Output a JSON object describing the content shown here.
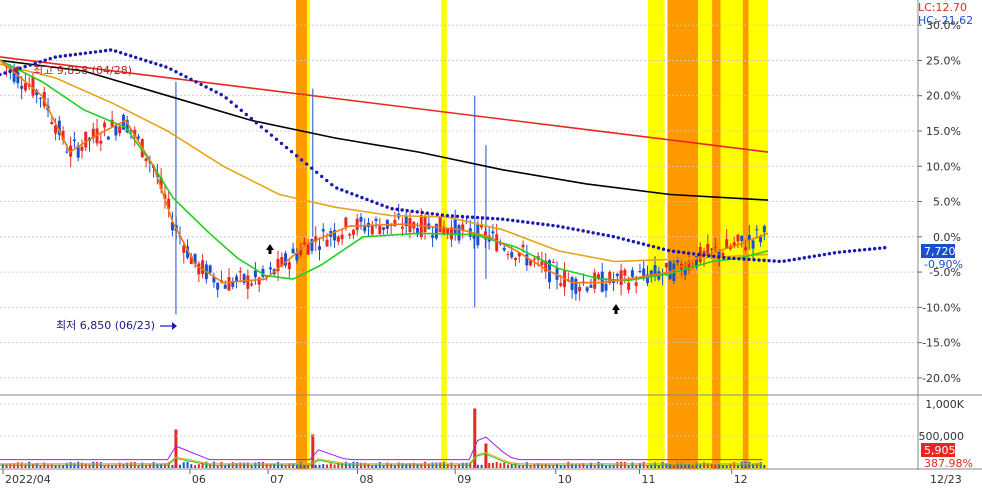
{
  "chart_data": {
    "type": "line",
    "price_panel": {
      "y_axis_unit": "%",
      "yticks": [
        "30.0%",
        "25.0%",
        "20.0%",
        "15.0%",
        "10.0%",
        "5.0%",
        "0.0%",
        "-5.0%",
        "-10.0%",
        "-15.0%",
        "-20.0%"
      ],
      "ytick_values": [
        30,
        25,
        20,
        15,
        10,
        5,
        0,
        -5,
        -10,
        -15,
        -20
      ],
      "ylim": [
        -22,
        33
      ],
      "lc_label": "LC:12.70",
      "hc_label": "HC:-21.62",
      "high_annotation": "최고 9,858 (04/28)",
      "low_annotation": "최저 6,850 (06/23)",
      "current_price_label": "7,720",
      "current_pct_label": "-0.90%",
      "grid": true
    },
    "volume_panel": {
      "yticks": [
        "1,000K",
        "500,000"
      ],
      "current_volume_label": "5,905",
      "volume_pct_label": "387.98%"
    },
    "x_axis": {
      "labels": [
        "2022/04",
        "06",
        "07",
        "08",
        "09",
        "10",
        "11",
        "12",
        "12/23"
      ],
      "label_days": [
        0,
        68,
        96,
        128,
        163,
        199,
        229,
        262,
        0
      ]
    },
    "series": [
      {
        "name": "",
        "color": "#e8281e",
        "x": [
          0,
          275
        ],
        "y": [
          25.5,
          12.0
        ]
      },
      {
        "name": "",
        "color": "#000000",
        "x": [
          0,
          30,
          60,
          90,
          120,
          150,
          180,
          210,
          240,
          275
        ],
        "y": [
          25.0,
          23.5,
          20.0,
          16.5,
          14.0,
          12.0,
          9.5,
          7.5,
          6.0,
          5.2
        ]
      },
      {
        "name": "",
        "color": "#e8a317",
        "x": [
          0,
          20,
          40,
          60,
          80,
          100,
          120,
          140,
          160,
          180,
          200,
          220,
          240,
          260,
          275
        ],
        "y": [
          24.5,
          22.5,
          19.0,
          15.0,
          10.0,
          6.0,
          4.2,
          3.0,
          2.8,
          1.0,
          -2.0,
          -3.5,
          -3.2,
          -2.8,
          -2.5
        ]
      },
      {
        "name": "",
        "color": "#21cf21",
        "x": [
          0,
          15,
          30,
          45,
          55,
          62,
          75,
          85,
          95,
          105,
          115,
          130,
          150,
          170,
          185,
          200,
          215,
          225,
          240,
          255,
          265,
          275
        ],
        "y": [
          25.0,
          22.0,
          18.0,
          15.5,
          10.0,
          5.5,
          0.5,
          -3.0,
          -5.5,
          -6.0,
          -4.0,
          0.0,
          0.5,
          0.3,
          -1.5,
          -4.5,
          -6.0,
          -6.2,
          -5.2,
          -3.5,
          -3.0,
          -2.0
        ]
      },
      {
        "name": "",
        "color": "#f07a14",
        "x": [
          0,
          15,
          25,
          35,
          45,
          55,
          62,
          70,
          80,
          95,
          110,
          125,
          145,
          165,
          175,
          185,
          195,
          205,
          215,
          225,
          240,
          250,
          265,
          275
        ],
        "y": [
          25.0,
          20.0,
          12.0,
          14.5,
          16.5,
          10.0,
          2.0,
          -4.0,
          -6.5,
          -6.0,
          -1.0,
          1.5,
          1.8,
          1.0,
          0.0,
          -2.0,
          -4.5,
          -6.5,
          -6.5,
          -6.0,
          -5.0,
          -3.0,
          -1.0,
          0.5
        ]
      },
      {
        "name": "",
        "color": "#1a1ab0",
        "x": [
          0,
          20,
          40,
          60,
          80,
          100,
          120,
          140,
          160,
          180,
          200,
          220,
          240,
          260,
          280,
          300,
          318
        ],
        "y": [
          23.0,
          25.5,
          26.5,
          24.0,
          20.0,
          13.5,
          7.0,
          4.0,
          3.0,
          2.5,
          1.5,
          0.0,
          -2.0,
          -3.0,
          -3.5,
          -2.2,
          -1.5
        ]
      }
    ],
    "highlight_bands": [
      {
        "color": "#ff9900",
        "start": 106,
        "end": 110
      },
      {
        "color": "#ffff00",
        "start": 110,
        "end": 111
      },
      {
        "color": "#ffff00",
        "start": 158,
        "end": 160
      },
      {
        "color": "#ffff00",
        "start": 232,
        "end": 238
      },
      {
        "color": "#ff9900",
        "start": 239,
        "end": 250
      },
      {
        "color": "#ffff00",
        "start": 250,
        "end": 275
      },
      {
        "color": "#ff9900",
        "start": 255,
        "end": 258
      },
      {
        "color": "#ff9900",
        "start": 266,
        "end": 268
      }
    ],
    "volume_spikes": [
      {
        "x": 63,
        "v": 0.55
      },
      {
        "x": 112,
        "v": 0.48
      },
      {
        "x": 170,
        "v": 0.85
      },
      {
        "x": 174,
        "v": 0.35
      }
    ]
  }
}
